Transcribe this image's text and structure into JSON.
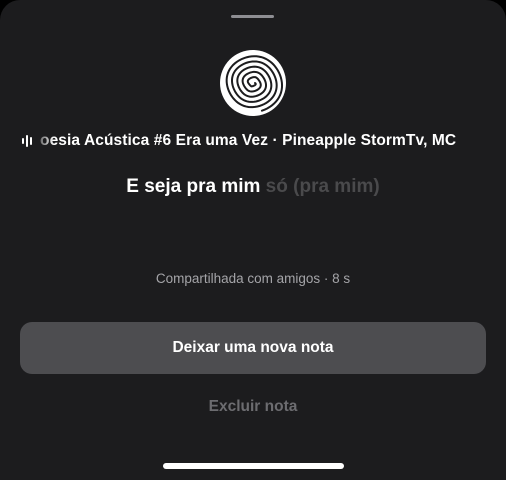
{
  "note": {
    "track_title": "oesia Acústica #6 Era uma Vez · Pineapple StormTv, MC",
    "lyric_sung": "E seja pra mim",
    "lyric_upcoming": " só (pra mim)",
    "meta": "Compartilhada com amigos · 8 s"
  },
  "actions": {
    "leave_note_label": "Deixar uma nova nota",
    "delete_note_label": "Excluir nota"
  },
  "icons": {
    "artwork": "swirl-spiral-icon",
    "playing": "equalizer-bars-icon"
  },
  "colors": {
    "sheet_background": "#1c1c1e",
    "primary_button": "#4d4d50",
    "lyric_active": "#ffffff",
    "lyric_inactive": "#4a4a4c",
    "secondary_text": "#a4a4a8",
    "destructive_text": "#6c6c70"
  }
}
